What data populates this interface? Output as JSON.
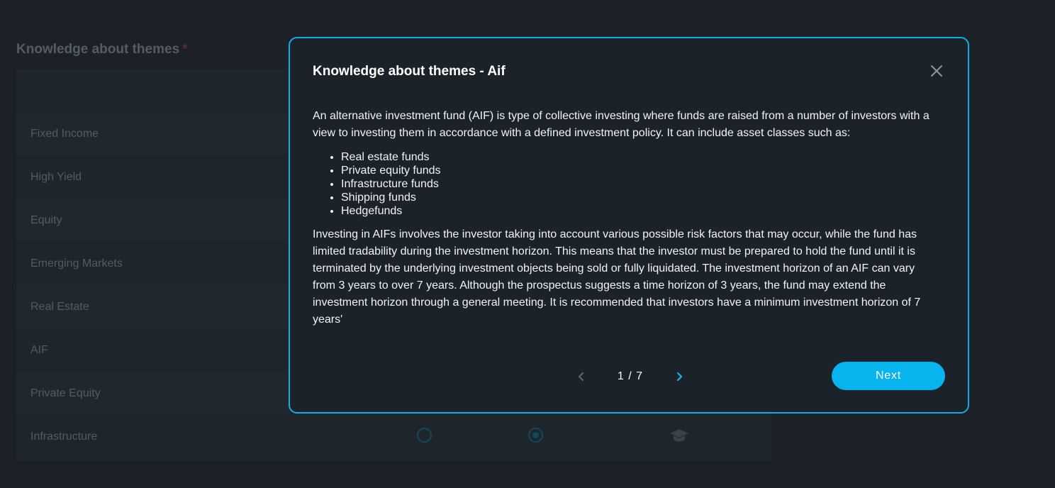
{
  "background": {
    "title": "Knowledge about themes",
    "required_mark": "*",
    "themes": [
      {
        "label": "Fixed Income"
      },
      {
        "label": "High Yield"
      },
      {
        "label": "Equity"
      },
      {
        "label": "Emerging Markets"
      },
      {
        "label": "Real Estate"
      },
      {
        "label": "AIF"
      },
      {
        "label": "Private Equity"
      },
      {
        "label": "Infrastructure"
      }
    ],
    "icons": [
      "radio-unchecked",
      "radio-checked",
      "graduation-cap-icon"
    ]
  },
  "modal": {
    "title": "Knowledge about themes - Aif",
    "intro": "An alternative investment fund (AIF) is type of collective investing where funds are raised from a number of investors with a view to investing them in accordance with a defined investment policy. It can include asset classes such as:",
    "list": [
      "Real estate funds",
      "Private equity funds",
      "Infrastructure funds",
      "Shipping funds",
      "Hedgefunds"
    ],
    "details": "Investing in AIFs involves the investor taking into account various possible risk factors that may occur, while the fund has limited tradability during the investment horizon. This means that the investor must be prepared to hold the fund until it is terminated by the underlying investment objects being sold or fully liquidated. The investment horizon of an AIF can vary from 3 years to over 7 years. Although the prospectus suggests a time horizon of 3 years, the fund may extend the investment horizon through a general meeting. It is recommended that investors have a minimum investment horizon of 7 years'",
    "pager": "1 / 7",
    "next_label": "Next"
  },
  "colors": {
    "accent": "#08b4ee",
    "modal_border": "#10aee6",
    "background": "#1b2127"
  }
}
